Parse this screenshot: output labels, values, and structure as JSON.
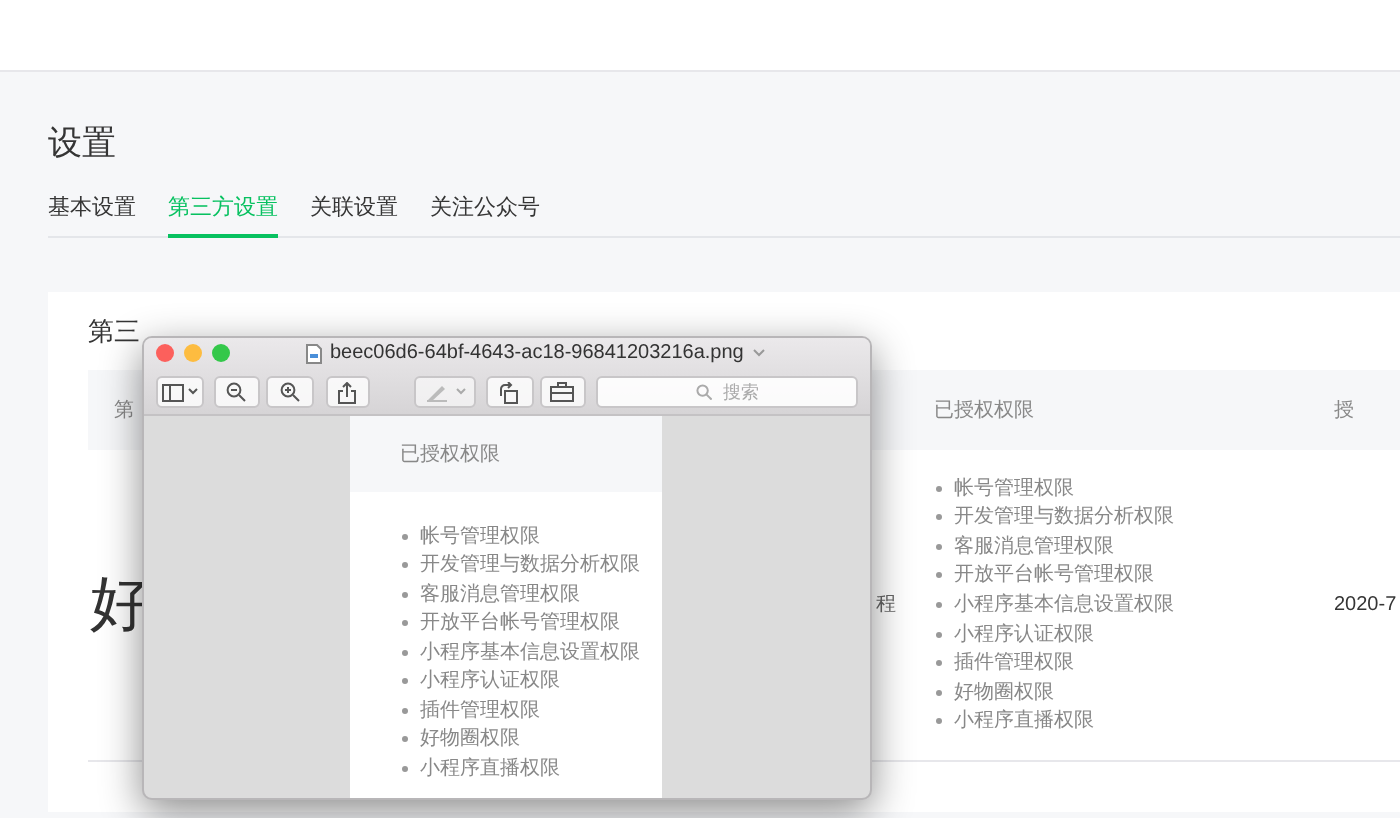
{
  "page": {
    "title": "设置",
    "tabs": [
      {
        "label": "基本设置",
        "selected": false
      },
      {
        "label": "第三方设置",
        "selected": true
      },
      {
        "label": "关联设置",
        "selected": false
      },
      {
        "label": "关注公众号",
        "selected": false
      }
    ]
  },
  "card": {
    "title": "第三",
    "table": {
      "columns": [
        "第",
        "",
        "已授权权限",
        "授"
      ],
      "rows": [
        {
          "logo": "好",
          "name": "程",
          "permissions": [
            "帐号管理权限",
            "开发管理与数据分析权限",
            "客服消息管理权限",
            "开放平台帐号管理权限",
            "小程序基本信息设置权限",
            "小程序认证权限",
            "插件管理权限",
            "好物圈权限",
            "小程序直播权限"
          ],
          "date": "2020-7"
        }
      ]
    }
  },
  "preview_window": {
    "title": "beec06d6-64bf-4643-ac18-96841203216a.png",
    "search": {
      "placeholder": "搜索"
    },
    "image": {
      "column": "已授权权限",
      "permissions": [
        "帐号管理权限",
        "开发管理与数据分析权限",
        "客服消息管理权限",
        "开放平台帐号管理权限",
        "小程序基本信息设置权限",
        "小程序认证权限",
        "插件管理权限",
        "好物圈权限",
        "小程序直播权限"
      ]
    }
  }
}
